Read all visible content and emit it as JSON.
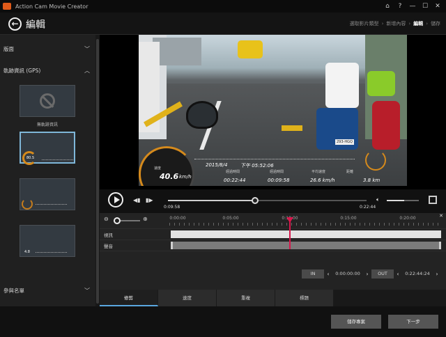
{
  "app": {
    "title": "Action Cam Movie Creator"
  },
  "window_controls": {
    "store_icon": "store-icon",
    "help": "?",
    "minimize": "—",
    "maximize": "☐",
    "close": "✕"
  },
  "header": {
    "back_icon": "arrow-left-icon",
    "title": "編輯",
    "breadcrumb": [
      {
        "label": "選取影片類型"
      },
      {
        "label": "新增內容"
      },
      {
        "label": "編輯",
        "active": true
      },
      {
        "label": "儲存"
      }
    ]
  },
  "left_panel": {
    "sections": [
      {
        "label": "版面",
        "expanded": false
      },
      {
        "label": "軌跡資訊 (GPS)",
        "expanded": true
      },
      {
        "label": "參與名單",
        "expanded": false
      }
    ],
    "gps_options": [
      {
        "label": "無軌跡資訊",
        "icon": "no-entry-icon",
        "selected": false
      },
      {
        "label": "",
        "selected": true,
        "gauge_value": "80.5"
      },
      {
        "label": "",
        "selected": false
      },
      {
        "label": "",
        "selected": false,
        "gauge_value": "4.8"
      }
    ]
  },
  "video_overlay": {
    "date": "2015/8/4",
    "time": "下午 05:52:06",
    "speed": "40.6",
    "speed_unit": "km/h",
    "speed_caption": "速度",
    "elapsed": "00:22:44",
    "elapsed_caption": "經過時間",
    "duration": "00:09:58",
    "duration_caption": "經過時間",
    "avg_speed": "26.6 km/h",
    "avg_speed_caption": "平均速度",
    "distance": "3.8 km",
    "distance_caption": "距離",
    "plate": "293-HGQ"
  },
  "transport": {
    "current_time": "0:09:58",
    "total_time": "0:22:44",
    "progress": 0.4384,
    "volume": 0.55
  },
  "timeline": {
    "ruler_labels": [
      "0:00:00",
      "0:05:00",
      "0:10:00",
      "0:15:00",
      "0:20:00"
    ],
    "tracks": [
      {
        "label": "視訊"
      },
      {
        "label": "聲音"
      }
    ],
    "playhead_time": "0:09:58",
    "in_label": "IN",
    "in_time": "0:00:00:00",
    "out_label": "OUT",
    "out_time": "0:22:44:24"
  },
  "tabs": [
    {
      "label": "修剪",
      "active": true
    },
    {
      "label": "速度"
    },
    {
      "label": "重複"
    },
    {
      "label": "標題"
    }
  ],
  "footer": {
    "save_project": "儲存專案",
    "next": "下一步"
  }
}
